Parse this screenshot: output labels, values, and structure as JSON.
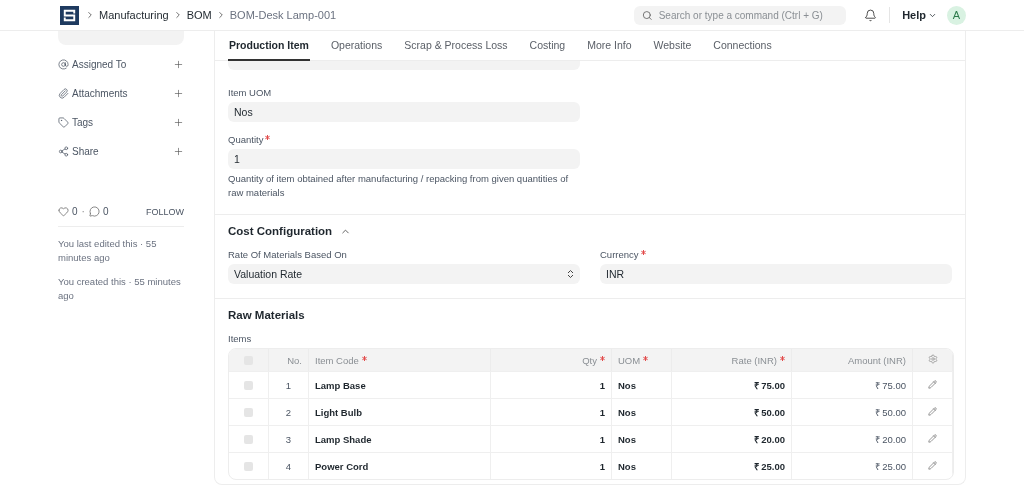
{
  "breadcrumbs": [
    "Manufacturing",
    "BOM",
    "BOM-Desk Lamp-001"
  ],
  "search": {
    "placeholder": "Search or type a command (Ctrl + G)"
  },
  "help": "Help",
  "avatar": "A",
  "sidebar": {
    "actions": [
      {
        "label": "Assigned To",
        "kind": "assign"
      },
      {
        "label": "Attachments",
        "kind": "attach"
      },
      {
        "label": "Tags",
        "kind": "tag"
      },
      {
        "label": "Share",
        "kind": "share"
      }
    ],
    "likes": "0",
    "separator": "·",
    "comments": "0",
    "follow": "FOLLOW",
    "activity": [
      "You last edited this · 55 minutes ago",
      "You created this · 55 minutes ago"
    ]
  },
  "tabs": [
    {
      "label": "Production Item",
      "selected": true
    },
    {
      "label": "Operations",
      "selected": false
    },
    {
      "label": "Scrap & Process Loss",
      "selected": false
    },
    {
      "label": "Costing",
      "selected": false
    },
    {
      "label": "More Info",
      "selected": false
    },
    {
      "label": "Website",
      "selected": false
    },
    {
      "label": "Connections",
      "selected": false
    }
  ],
  "item_uom": {
    "label": "Item UOM",
    "value": "Nos"
  },
  "quantity": {
    "label": "Quantity",
    "required": true,
    "value": "1",
    "description": "Quantity of item obtained after manufacturing / repacking from given quantities of raw materials"
  },
  "cost_configuration": {
    "title": "Cost Configuration",
    "expanded": true,
    "rate_basis": {
      "label": "Rate Of Materials Based On",
      "value": "Valuation Rate"
    },
    "currency": {
      "label": "Currency",
      "required": true,
      "value": "INR"
    }
  },
  "raw_materials": {
    "title": "Raw Materials",
    "items_label": "Items",
    "all_selected": false,
    "columns": [
      {
        "label": "No.",
        "required": false
      },
      {
        "label": "Item Code",
        "required": true
      },
      {
        "label": "Qty",
        "required": true
      },
      {
        "label": "UOM",
        "required": true
      },
      {
        "label": "Rate (INR)",
        "required": true
      },
      {
        "label": "Amount (INR)",
        "required": false
      }
    ],
    "rows": [
      {
        "selected": false,
        "no": "1",
        "item_code": "Lamp Base",
        "qty": "1",
        "uom": "Nos",
        "rate": "₹ 75.00",
        "amount": "₹ 75.00"
      },
      {
        "selected": false,
        "no": "2",
        "item_code": "Light Bulb",
        "qty": "1",
        "uom": "Nos",
        "rate": "₹ 50.00",
        "amount": "₹ 50.00"
      },
      {
        "selected": false,
        "no": "3",
        "item_code": "Lamp Shade",
        "qty": "1",
        "uom": "Nos",
        "rate": "₹ 20.00",
        "amount": "₹ 20.00"
      },
      {
        "selected": false,
        "no": "4",
        "item_code": "Power Cord",
        "qty": "1",
        "uom": "Nos",
        "rate": "₹ 25.00",
        "amount": "₹ 25.00"
      }
    ]
  }
}
